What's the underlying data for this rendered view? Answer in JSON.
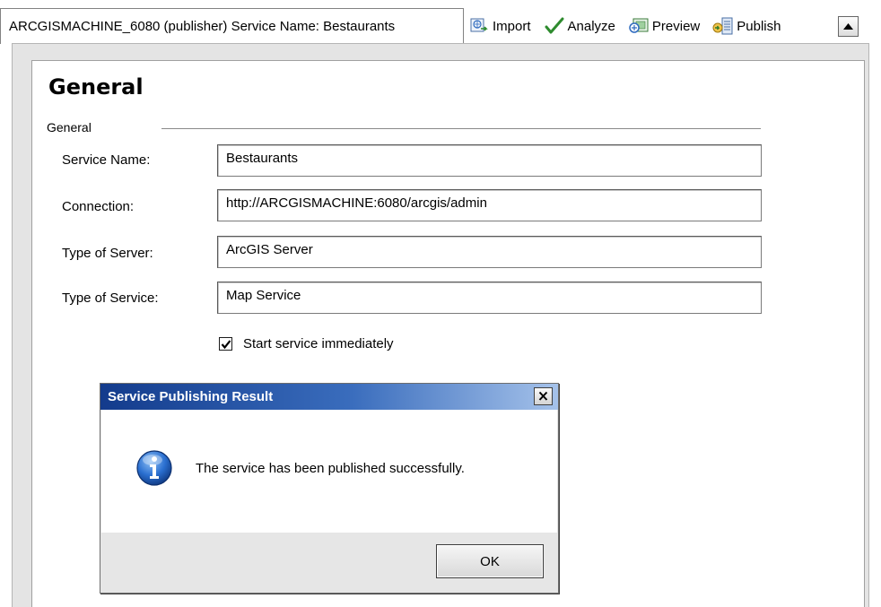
{
  "tab": {
    "title": "ARCGISMACHINE_6080 (publisher) Service Name: Bestaurants"
  },
  "toolbar": {
    "import_label": "Import",
    "analyze_label": "Analyze",
    "preview_label": "Preview",
    "publish_label": "Publish"
  },
  "page": {
    "heading": "General",
    "group_label": "General",
    "fields": [
      {
        "label": "Service Name:",
        "value": "Bestaurants"
      },
      {
        "label": "Connection:",
        "value": "http://ARCGISMACHINE:6080/arcgis/admin"
      },
      {
        "label": "Type of Server:",
        "value": "ArcGIS Server"
      },
      {
        "label": "Type of Service:",
        "value": "Map Service"
      }
    ],
    "start_checkbox": {
      "label": "Start service immediately",
      "checked": true
    }
  },
  "dialog": {
    "title": "Service Publishing Result",
    "message": "The service has been published successfully.",
    "ok_label": "OK"
  },
  "icons": [
    "import-icon",
    "analyze-check-icon",
    "preview-icon",
    "publish-icon",
    "collapse-arrow-icon",
    "close-icon",
    "info-icon"
  ]
}
